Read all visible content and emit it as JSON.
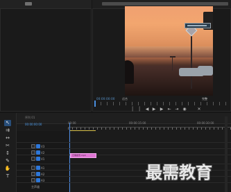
{
  "app": {
    "program_time": "00:00:00:00",
    "program_fit": "适合",
    "program_full": "完整",
    "timeline_title": "序列 01",
    "timeline_time": "00:00:00:00",
    "ruler_labels": [
      "00:00",
      "00:00:15:00",
      "00:00:30:00"
    ],
    "clip_label": "日落街景.mp4",
    "watermark": "最需教育"
  },
  "icons": {
    "play": "play-icon",
    "step_back": "step-back-icon",
    "step_forward": "step-forward-icon",
    "mark_in": "mark-in-icon",
    "mark_out": "mark-out-icon",
    "lift": "lift-icon",
    "extract": "extract-icon",
    "export_frame": "camera-icon",
    "settings": "wrench-icon",
    "selection": "selection-tool-icon",
    "track_select": "track-select-tool-icon",
    "ripple": "ripple-edit-tool-icon",
    "razor": "razor-tool-icon",
    "slip": "slip-tool-icon",
    "pen": "pen-tool-icon",
    "hand": "hand-tool-icon",
    "type": "type-tool-icon"
  },
  "tracks": [
    {
      "name": "V3"
    },
    {
      "name": "V2"
    },
    {
      "name": "V1"
    },
    {
      "name": "A1"
    },
    {
      "name": "A2"
    },
    {
      "name": "A3"
    },
    {
      "name": "主声道"
    }
  ]
}
